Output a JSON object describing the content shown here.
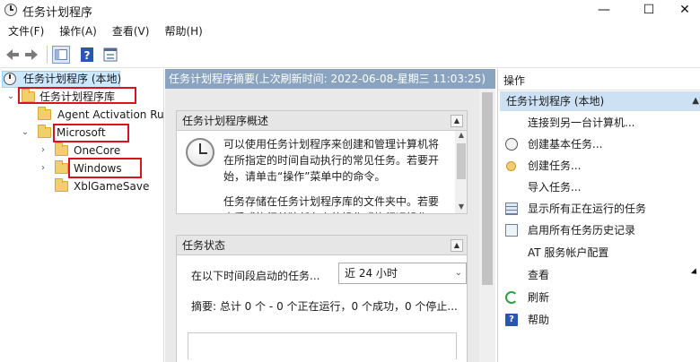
{
  "window": {
    "title": "任务计划程序",
    "controls": {
      "minimize": "—",
      "maximize": "☐",
      "close": "✕"
    }
  },
  "menu": [
    "文件(F)",
    "操作(A)",
    "查看(V)",
    "帮助(H)"
  ],
  "toolbar": {
    "back": "back-arrow-icon",
    "forward": "forward-arrow-icon",
    "show_hide": "show-hide-tree-icon",
    "help": "help-icon",
    "properties": "properties-icon"
  },
  "tree": {
    "root": "任务计划程序 (本地)",
    "library": "任务计划程序库",
    "agent": "Agent Activation Runtime",
    "microsoft": "Microsoft",
    "onecore": "OneCore",
    "windows": "Windows",
    "xbl": "XblGameSave"
  },
  "summary": {
    "header": "任务计划程序摘要(上次刷新时间: 2022-06-08-星期三 11:03:25)",
    "overview_title": "任务计划程序概述",
    "overview_p1": "可以使用任务计划程序来创建和管理计算机将在所指定的时间自动执行的常见任务。若要开始，请单击“操作”菜单中的命令。",
    "overview_p2": "任务存储在任务计划程序库的文件夹中。若要查看或执行单独任务上的操作或执行运操作，请",
    "status_title": "任务状态",
    "status_label": "在以下时间段启动的任务...",
    "status_select": "近 24 小时",
    "status_summary": "摘要: 总计 0 个 - 0 个正在运行，0 个成功，0 个停止..."
  },
  "actions": {
    "header": "操作",
    "section": "任务计划程序 (本地)",
    "items": [
      {
        "label": "连接到另一台计算机...",
        "icon": ""
      },
      {
        "label": "创建基本任务...",
        "icon": "clock-icon"
      },
      {
        "label": "创建任务...",
        "icon": "task-icon"
      },
      {
        "label": "导入任务...",
        "icon": ""
      },
      {
        "label": "显示所有正在运行的任务",
        "icon": "running-tasks-icon"
      },
      {
        "label": "启用所有任务历史记录",
        "icon": "history-icon"
      },
      {
        "label": "AT 服务帐户配置",
        "icon": ""
      },
      {
        "label": "查看",
        "icon": ""
      },
      {
        "label": "刷新",
        "icon": "refresh-icon"
      },
      {
        "label": "帮助",
        "icon": "help-icon"
      }
    ]
  },
  "colors": {
    "highlight_box": "#d9141c",
    "summary_header": "#8aa3bf",
    "selected_action": "#cde1f5"
  }
}
